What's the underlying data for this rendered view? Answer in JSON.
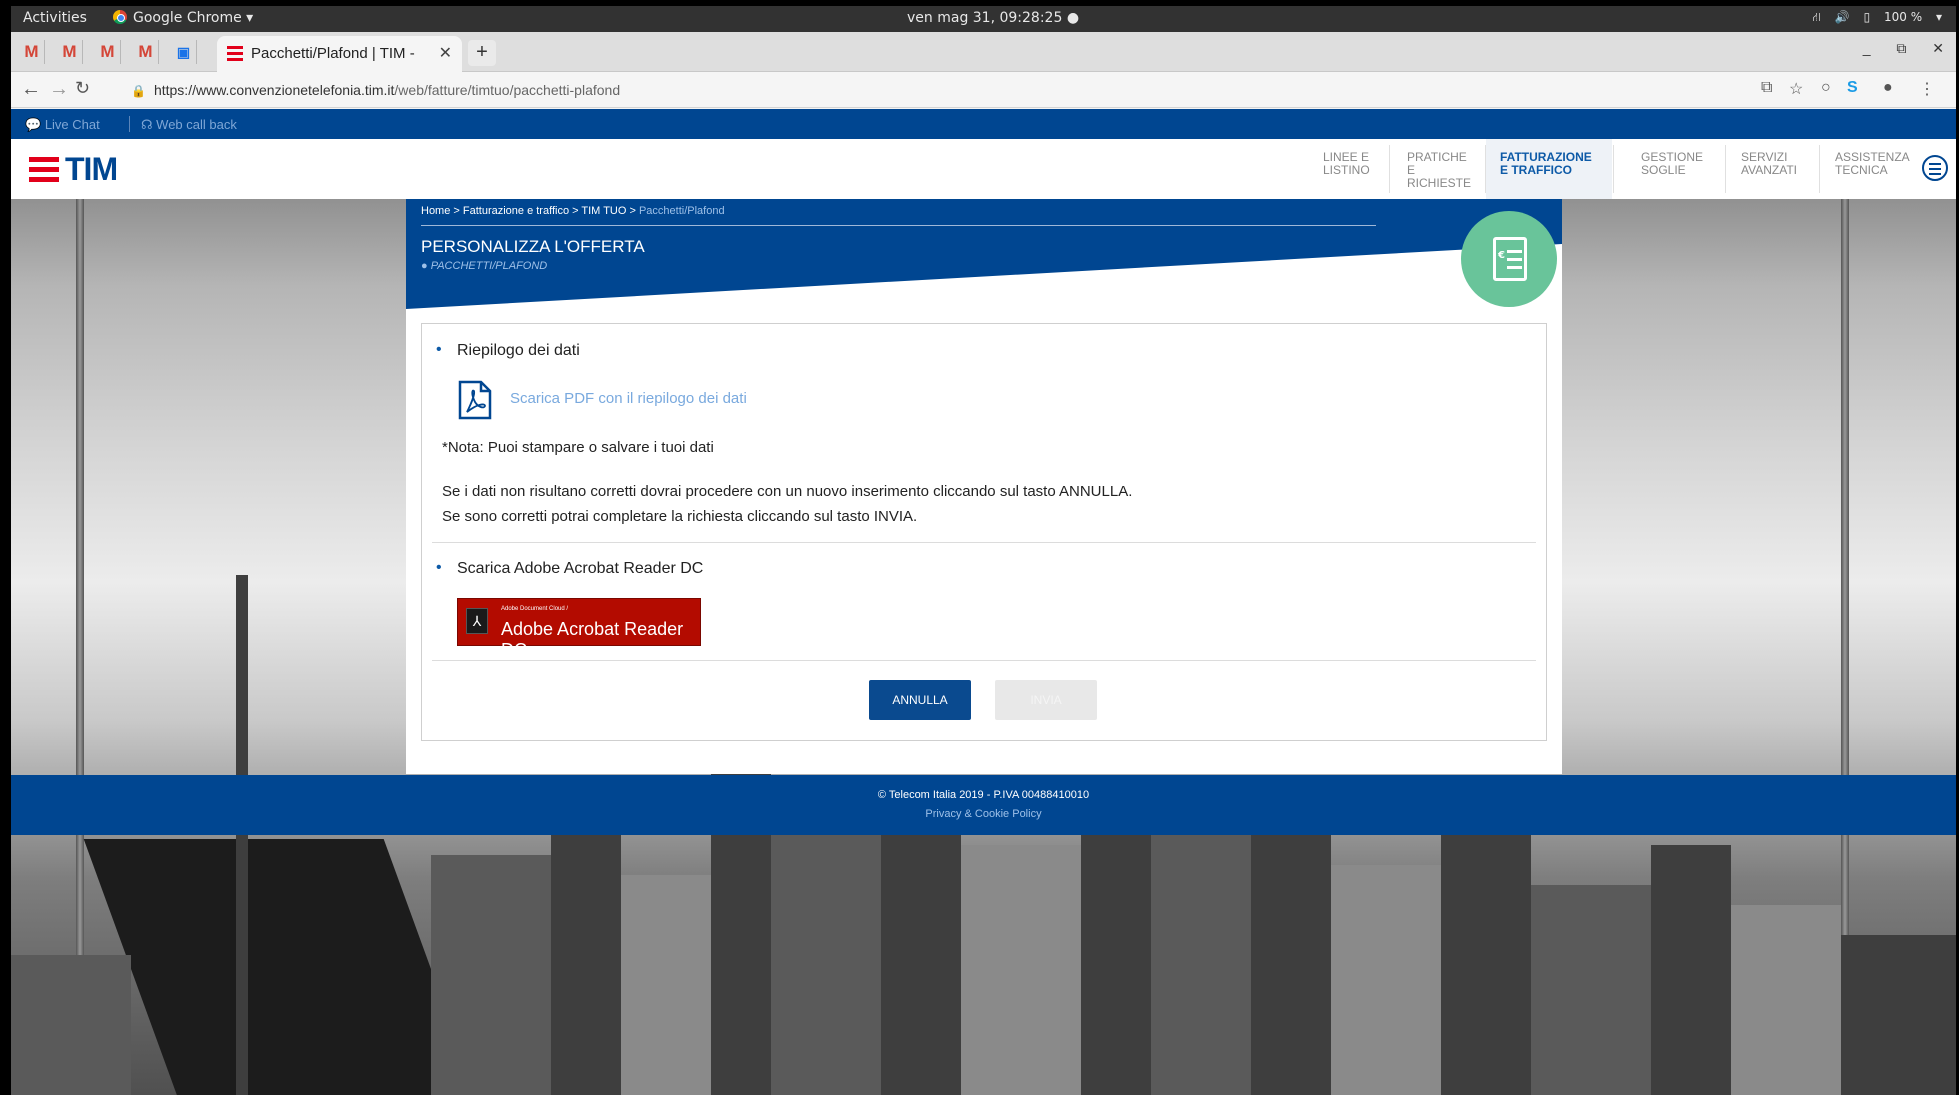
{
  "os_bar": {
    "activities": "Activities",
    "app": "Google Chrome ▾",
    "clock": "ven mag 31, 09:28:25 ●",
    "battery": "100 %"
  },
  "browser": {
    "tab_title": "Pacchetti/Plafond | TIM - ",
    "new_tab": "+",
    "url_host": "https://www.convenzionetelefonia.tim.it",
    "url_path": "/web/fatture/timtuo/pacchetti-plafond"
  },
  "topbar": {
    "live_chat": "Live Chat",
    "web_call_back": "Web call back"
  },
  "brand": {
    "logo_text": "TIM",
    "accent": "#e2001a",
    "primary": "#004691"
  },
  "menu": {
    "items": [
      {
        "label": "LINEE E LISTINO"
      },
      {
        "label": "PRATICHE E RICHIESTE"
      },
      {
        "label": "FATTURAZIONE E TRAFFICO"
      },
      {
        "label": "GESTIONE SOGLIE"
      },
      {
        "label": "SERVIZI AVANZATI"
      },
      {
        "label": "ASSISTENZA TECNICA"
      }
    ]
  },
  "breadcrumb": {
    "path": "Home > Fatturazione e traffico > TIM TUO > ",
    "current": "Pacchetti/Plafond"
  },
  "banner": {
    "title": "PERSONALIZZA L'OFFERTA",
    "subtitle": "● PACCHETTI/PLAFOND"
  },
  "summary": {
    "heading": "Riepilogo dei dati",
    "pdf_link": "Scarica PDF con il riepilogo dei dati",
    "note": "*Nota: Puoi stampare o salvare i tuoi dati",
    "line1": "Se i dati non risultano corretti dovrai procedere con un nuovo inserimento cliccando sul tasto ANNULLA.",
    "line2": "Se sono corretti potrai completare la richiesta cliccando sul tasto INVIA."
  },
  "acrobat": {
    "heading": "Scarica Adobe Acrobat Reader DC",
    "badge_small": "Adobe Document Cloud /",
    "badge_big": "Adobe Acrobat Reader DC"
  },
  "actions": {
    "cancel": "ANNULLA",
    "send": "INVIA"
  },
  "footer": {
    "copyright": "© Telecom Italia 2019 - P.IVA 00488410010",
    "privacy": "Privacy & Cookie Policy"
  }
}
